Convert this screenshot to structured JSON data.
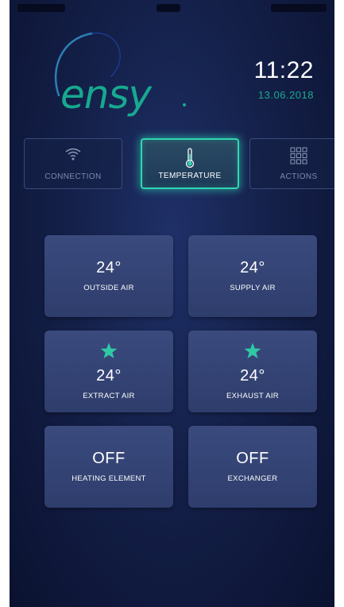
{
  "brand": {
    "logo_text": "ensy",
    "accent_color": "#17a98f"
  },
  "clock": {
    "time": "11:22",
    "date": "13.06.2018"
  },
  "tabs": [
    {
      "label": "CONNECTION",
      "icon": "wifi-icon",
      "active": false
    },
    {
      "label": "TEMPERATURE",
      "icon": "thermometer-icon",
      "active": true
    },
    {
      "label": "ACTIONS",
      "icon": "grid-icon",
      "active": false
    }
  ],
  "tiles": [
    {
      "value": "24°",
      "label": "OUTSIDE AIR",
      "star": false
    },
    {
      "value": "24°",
      "label": "SUPPLY AIR",
      "star": false
    },
    {
      "value": "24°",
      "label": "EXTRACT AIR",
      "star": true
    },
    {
      "value": "24°",
      "label": "EXHAUST AIR",
      "star": true
    },
    {
      "value": "OFF",
      "label": "HEATING ELEMENT",
      "star": false
    },
    {
      "value": "OFF",
      "label": "EXCHANGER",
      "star": false
    }
  ],
  "colors": {
    "background": "#142049",
    "tile": "#34446f",
    "active_glow": "#2fd6b2",
    "star": "#2fc9a4"
  }
}
